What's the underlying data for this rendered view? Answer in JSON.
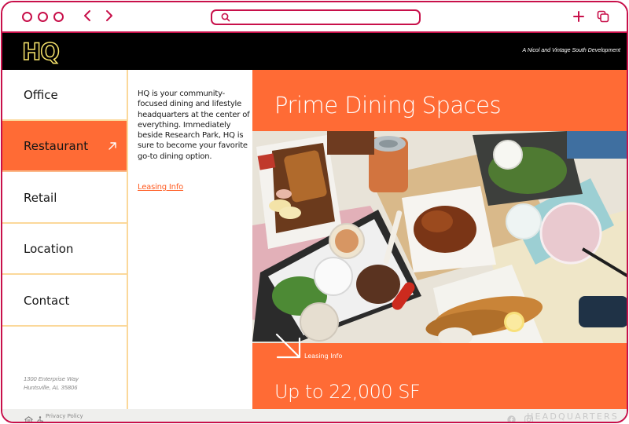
{
  "browser": {
    "window_controls": [
      "close-dot",
      "minimize-dot",
      "maximize-dot"
    ],
    "back_icon": "chevron-left-icon",
    "forward_icon": "chevron-right-icon",
    "address_bar": {
      "icon": "search-icon",
      "value": "",
      "placeholder": ""
    },
    "new_tab_icon": "plus-icon",
    "tabs_icon": "copy-tabs-icon",
    "accent_color": "#c8104a"
  },
  "header": {
    "logo_text": "HQ",
    "logo_color": "#f5e26a",
    "tagline": "A Nicol and Vintage South Development"
  },
  "sidebar": {
    "items": [
      {
        "label": "Office",
        "active": false
      },
      {
        "label": "Restaurant",
        "active": true,
        "icon": "arrow-up-right-icon"
      },
      {
        "label": "Retail",
        "active": false
      },
      {
        "label": "Location",
        "active": false
      },
      {
        "label": "Contact",
        "active": false
      }
    ],
    "address_line1": "1300 Enterprise Way",
    "address_line2": "Huntsville, AL 35806"
  },
  "intro": {
    "body": "HQ is your community-focused dining and lifestyle headquarters at the center of everything. Immediately beside Research Park, HQ is sure to become your favorite go-to dining option.",
    "link_label": "Leasing Info"
  },
  "hero": {
    "title": "Prime Dining Spaces",
    "photo_alt": "overhead photo of restaurant food: fried cutlet, drink can, wings, mezze platter, fish and chips, cocktail",
    "cta_icon": "arrow-down-right-icon",
    "cta_label": "Leasing Info",
    "size_text": "Up to 22,000 SF",
    "accent_color": "#ff6b35"
  },
  "footer": {
    "icons": [
      "equal-housing-icon",
      "accessibility-icon"
    ],
    "privacy_label": "Privacy Policy",
    "social_icons": [
      "facebook-icon",
      "instagram-icon"
    ],
    "brand_word": "HEADQUARTERS"
  }
}
